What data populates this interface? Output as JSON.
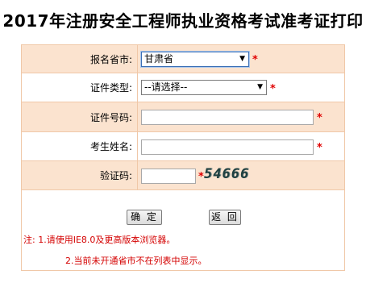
{
  "page": {
    "title": "2017年注册安全工程师执业资格考试准考证打印"
  },
  "form": {
    "province": {
      "label": "报名省市:",
      "value": "甘肃省",
      "required_mark": "*"
    },
    "id_type": {
      "label": "证件类型:",
      "value": "--请选择--",
      "required_mark": "*"
    },
    "id_number": {
      "label": "证件号码:",
      "value": "",
      "required_mark": "*"
    },
    "name": {
      "label": "考生姓名:",
      "value": "",
      "required_mark": "*"
    },
    "captcha": {
      "label": "验证码:",
      "value": "",
      "required_mark": "*",
      "image_text": "54666"
    }
  },
  "buttons": {
    "confirm": "确 定",
    "back": "返 回"
  },
  "notes": {
    "line1": "注: 1.请使用IE8.0及更高版本浏览器。",
    "line2": "2.当前未开通省市不在列表中显示。"
  },
  "colors": {
    "row_shaded": "#fbe3cf",
    "border": "#f0c8a8",
    "required": "#e00000",
    "note_text": "#d40000"
  }
}
